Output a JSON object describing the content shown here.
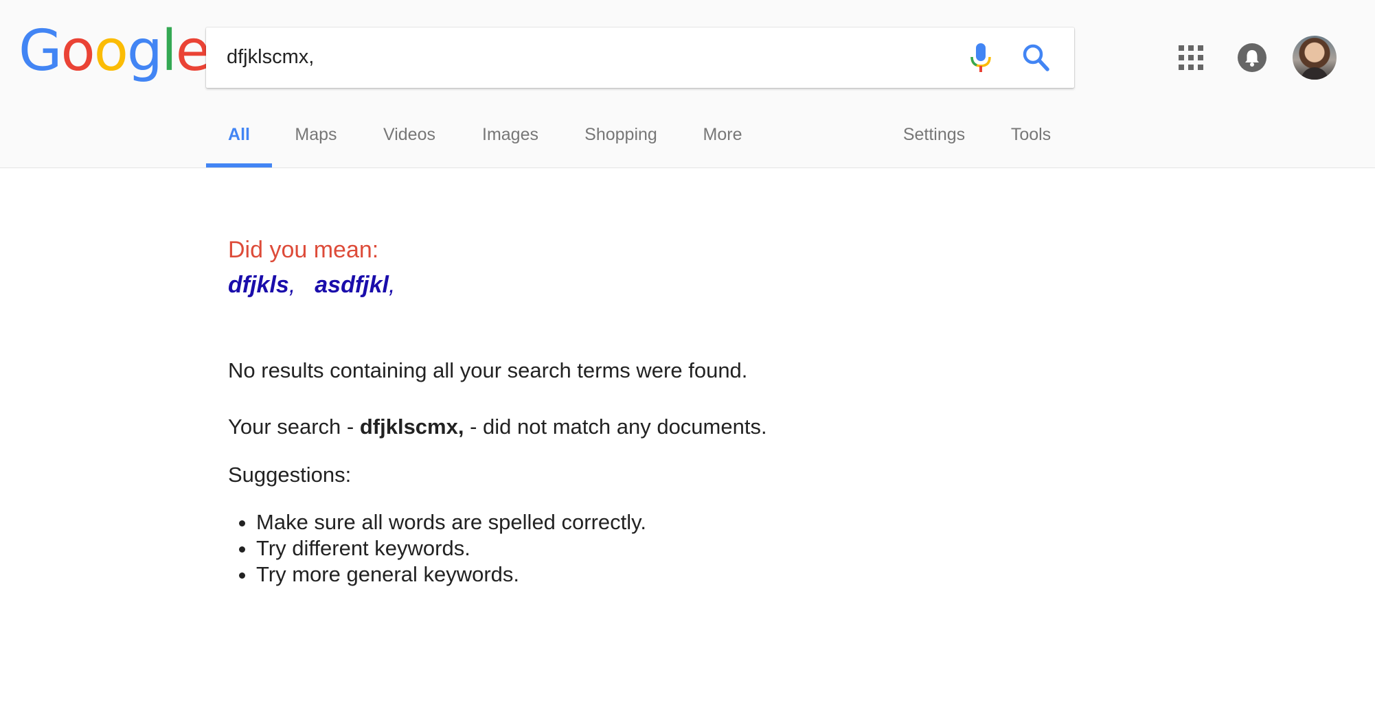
{
  "logo": {
    "letters": [
      "G",
      "o",
      "o",
      "g",
      "l",
      "e"
    ],
    "colors": [
      "#4285f4",
      "#ea4335",
      "#fbbc05",
      "#4285f4",
      "#34a853",
      "#ea4335"
    ]
  },
  "search": {
    "query": "dfjklscmx,"
  },
  "icons": {
    "mic": "microphone-icon",
    "search": "search-icon",
    "apps": "apps-grid-icon",
    "notifications": "bell-icon",
    "avatar": "profile-avatar"
  },
  "tabs": {
    "all": "All",
    "maps": "Maps",
    "videos": "Videos",
    "images": "Images",
    "shopping": "Shopping",
    "more": "More",
    "settings": "Settings",
    "tools": "Tools"
  },
  "spelling": {
    "heading": "Did you mean:",
    "suggestions": [
      {
        "text": "dfjkls",
        "suffix": ","
      },
      {
        "text": "asdfjkl",
        "suffix": ","
      }
    ]
  },
  "results": {
    "no_results": "No results containing all your search terms were found.",
    "your_search_prefix": "Your search - ",
    "your_search_term": "dfjklscmx,",
    "your_search_suffix": " - did not match any documents.",
    "suggestions_heading": "Suggestions:",
    "tips": [
      "Make sure all words are spelled correctly.",
      "Try different keywords.",
      "Try more general keywords."
    ]
  },
  "colors": {
    "accent": "#4285f4",
    "did_you_mean": "#dd4b39",
    "link": "#1a0dab"
  }
}
